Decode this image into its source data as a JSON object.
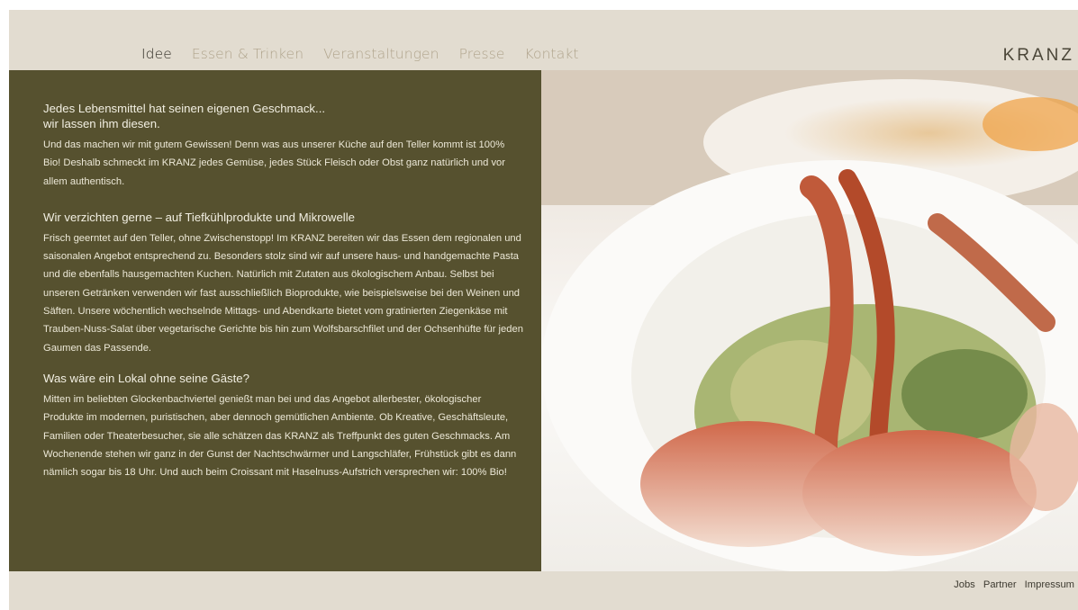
{
  "nav": {
    "items": [
      {
        "label": "Idee"
      },
      {
        "label": "Essen & Trinken"
      },
      {
        "label": "Veranstaltungen"
      },
      {
        "label": "Presse"
      },
      {
        "label": "Kontakt"
      }
    ]
  },
  "logo": "KRANZ",
  "content": {
    "sections": [
      {
        "heading_line1": "Jedes Lebensmittel hat seinen eigenen Geschmack...",
        "heading_line2": "wir lassen ihm diesen.",
        "body": "Und das machen wir mit gutem Gewissen! Denn was aus unserer Küche auf den Teller kommt ist 100% Bio! Deshalb schmeckt im KRANZ jedes Gemüse, jedes Stück Fleisch oder Obst ganz natürlich und vor allem authentisch."
      },
      {
        "heading_line1": "Wir verzichten gerne – auf Tiefkühlprodukte und Mikrowelle",
        "body": "Frisch geerntet auf den Teller, ohne Zwischenstopp! Im KRANZ bereiten wir das Essen dem regionalen und saisonalen Angebot entsprechend zu. Besonders stolz sind wir auf unsere haus- und handgemachte Pasta und die ebenfalls hausgemachten Kuchen. Natürlich mit Zutaten aus ökologischem Anbau. Selbst bei unseren Getränken verwenden wir fast ausschließlich Bioprodukte, wie beispielsweise bei den Weinen und Säften. Unsere wöchentlich wechselnde Mittags- und Abendkarte bietet vom gratinierten Ziegenkäse mit Trauben-Nuss-Salat über vegetarische Gerichte bis hin zum Wolfsbarschfilet und der Ochsenhüfte für jeden Gaumen das Passende."
      },
      {
        "heading_line1": "Was wäre ein Lokal ohne seine Gäste?",
        "body": "Mitten im beliebten Glockenbachviertel genießt man bei und das Angebot allerbester, ökologischer Produkte im modernen, puristischen, aber dennoch gemütlichen Ambiente. Ob Kreative, Geschäftsleute, Familien oder Theaterbesucher, sie alle schätzen das KRANZ als Treffpunkt des guten Geschmacks. Am Wochenende stehen wir ganz in der Gunst der Nachtschwärmer und Langschläfer, Frühstück gibt es dann nämlich sogar bis 18 Uhr. Und auch beim Croissant mit Haselnuss-Aufstrich versprechen wir: 100% Bio!"
      }
    ]
  },
  "footer": {
    "links": [
      {
        "label": "Jobs"
      },
      {
        "label": "Partner"
      },
      {
        "label": "Impressum"
      }
    ]
  },
  "colors": {
    "background": "#e2dcd0",
    "panel": "#56512f",
    "nav_active": "#2d2a22",
    "nav_inactive": "#b0a48c"
  }
}
